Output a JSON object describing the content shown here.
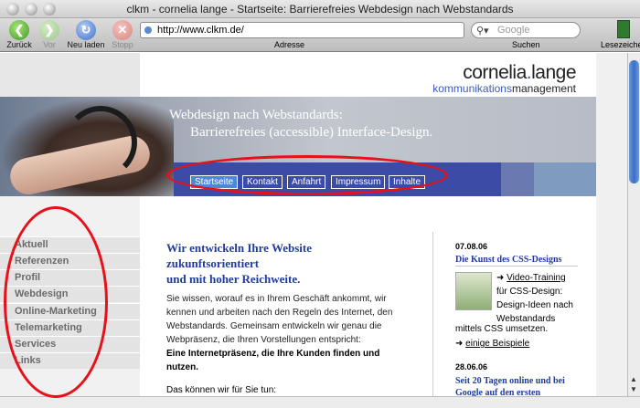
{
  "window": {
    "title": "clkm - cornelia lange - Startseite: Barrierefreies Webdesign nach Webstandards"
  },
  "toolbar": {
    "back_label": "Zurück",
    "forward_label": "Vor",
    "reload_label": "Neu laden",
    "stop_label": "Stopp",
    "address_value": "http://www.clkm.de/",
    "address_label": "Adresse",
    "search_placeholder": "Google",
    "search_label": "Suchen",
    "bookmarks_label": "Lesezeichen"
  },
  "site": {
    "logo_name_1": "cornelia",
    "logo_name_accent": ".",
    "logo_name_2": "lange",
    "logo_sub_1": "kommunikations",
    "logo_sub_2": "management",
    "banner_line1": "Webdesign nach Webstandards:",
    "banner_line2": "Barrierefreies (accessible) Interface-Design.",
    "nav": [
      "Startseite",
      "Kontakt",
      "Anfahrt",
      "Impressum",
      "Inhalte"
    ],
    "sidebar": [
      "Aktuell",
      "Referenzen",
      "Profil",
      "Webdesign",
      "Online-Marketing",
      "Telemarketing",
      "Services",
      "Links"
    ]
  },
  "main": {
    "headline_1": "Wir entwickeln Ihre Website",
    "headline_2": "zukunftsorientiert",
    "headline_3": "und mit hoher Reichweite.",
    "body_1": "Sie wissen, worauf es in Ihrem Geschäft ankommt, wir",
    "body_2": "kennen und arbeiten nach den Regeln des Internet, den",
    "body_3": "Webstandards. Gemeinsam entwickeln wir genau die",
    "body_4": "Webpräsenz, die Ihren Vorstellungen entspricht:",
    "bold_1": "Eine Internetpräsenz, die Ihre Kunden finden und",
    "bold_2": "nutzen.",
    "more": "Das können wir für Sie tun:"
  },
  "news": {
    "date_1": "07.08.06",
    "title_1": "Die Kunst des CSS-Designs",
    "link_1": "Video-Training",
    "text_1a": "für CSS-Design:",
    "text_1b": "Design-Ideen nach",
    "text_1c": "Webstandards",
    "text_1d": "mittels CSS umsetzen.",
    "link_2": "einige Beispiele",
    "date_2": "28.06.06",
    "title_2a": "Seit 20 Tagen online und bei",
    "title_2b": "Google auf den ersten"
  },
  "colors": {
    "headline_blue": "#1f3c9a",
    "nav_bar": "#3b4ba6",
    "nav_active": "#4d88d8",
    "annotation_red": "#e8101a"
  },
  "icons": [
    "back-icon",
    "forward-icon",
    "reload-icon",
    "stop-icon",
    "secure-dot-icon",
    "search-icon",
    "bookmarks-icon"
  ]
}
